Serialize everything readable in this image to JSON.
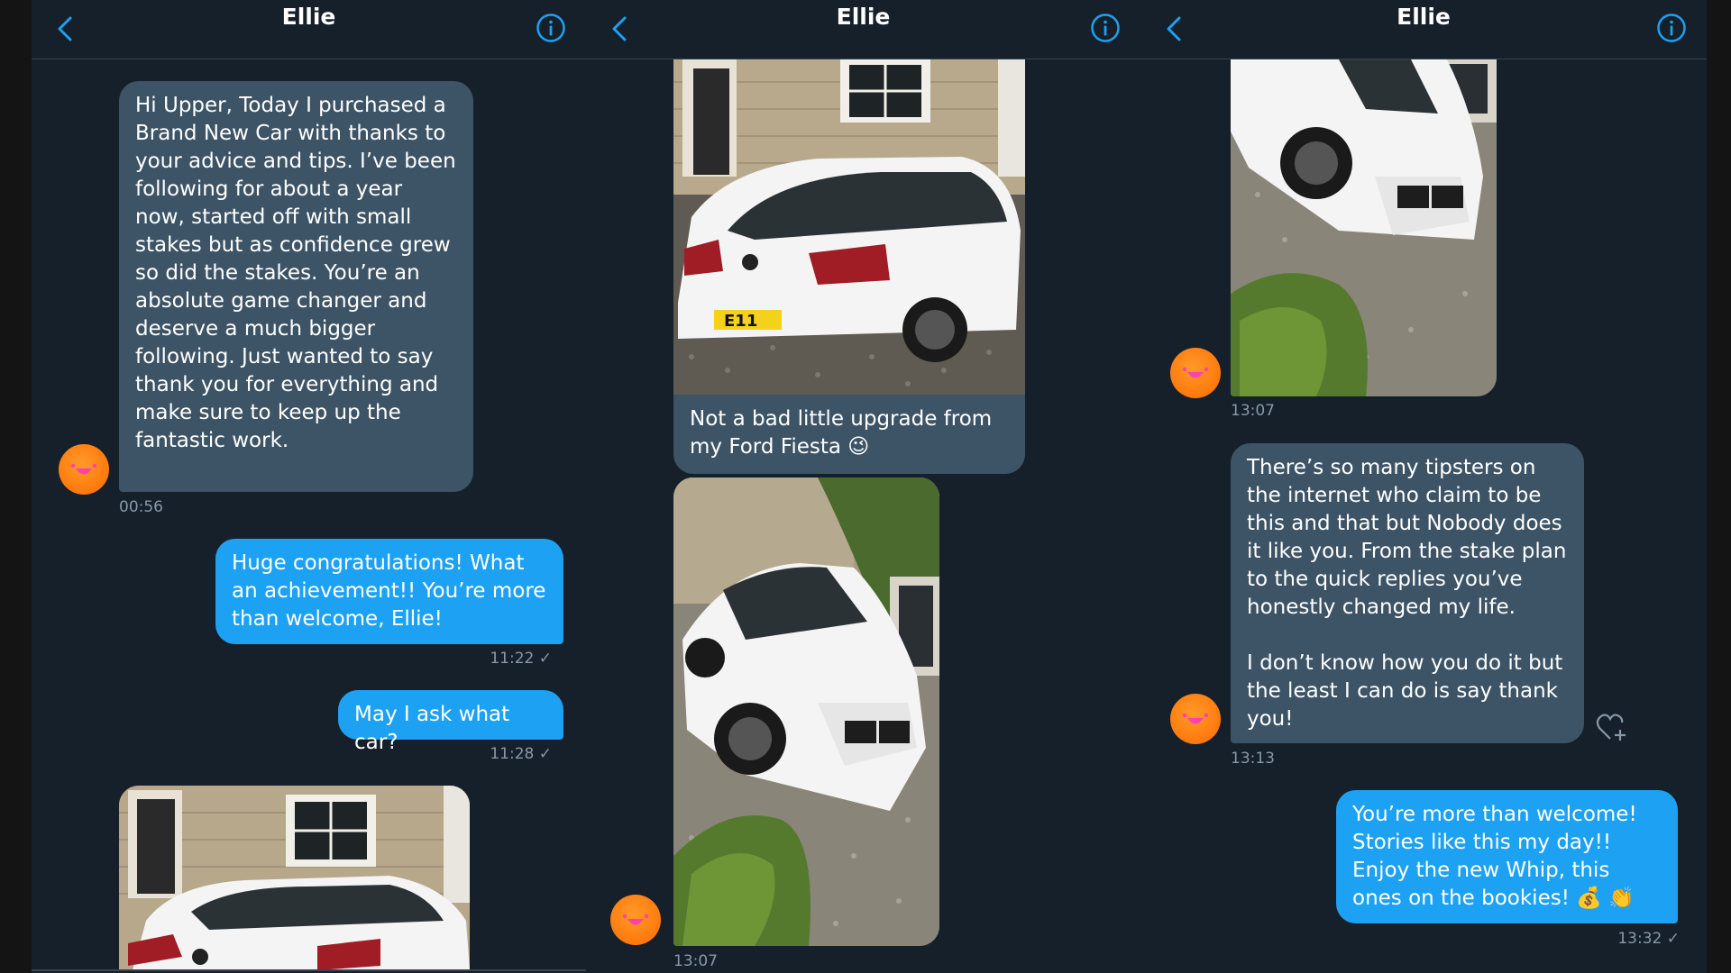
{
  "panels": [
    {
      "title": "Ellie",
      "messages": {
        "m1": "Hi Upper, Today I purchased a Brand New Car with thanks to your advice and tips. I’ve been following for about a year now, started off with small stakes but as confidence grew so did the stakes. You’re an absolute game changer and deserve a much bigger following. Just wanted to say thank you for everything and make sure to keep up the fantastic work.",
        "t1": "00:56",
        "m2": "Huge congratulations! What an achievement!! You’re more than welcome, Ellie!",
        "t2": "11:22 ✓",
        "m3": "May I ask what car?",
        "t3": "11:28 ✓"
      }
    },
    {
      "title": "Ellie",
      "messages": {
        "caption": "Not a bad little upgrade from my Ford Fiesta 😉",
        "plate": "E11",
        "t1": "13:07"
      }
    },
    {
      "title": "Ellie",
      "messages": {
        "t1": "13:07",
        "m1a": "There’s so many tipsters on the internet who claim to be this and that but Nobody does it like you. From the stake plan to the quick replies you’ve honestly changed my life.",
        "m1b": "I don’t know how you do it but the least I can do is say thank you!",
        "t2": "13:13",
        "m2": "You’re more than welcome! Stories like this my day!! Enjoy the new Whip, this ones on the bookies! 💰 👏",
        "t3": "13:32 ✓"
      }
    }
  ],
  "colors": {
    "background": "#15202b",
    "incoming_bubble": "#3d5466",
    "outgoing_bubble": "#1da1f2",
    "accent": "#1da1f2",
    "avatar": "#ff7a10"
  },
  "icons": [
    "back-chevron-icon",
    "info-icon",
    "heart-plus-icon"
  ]
}
